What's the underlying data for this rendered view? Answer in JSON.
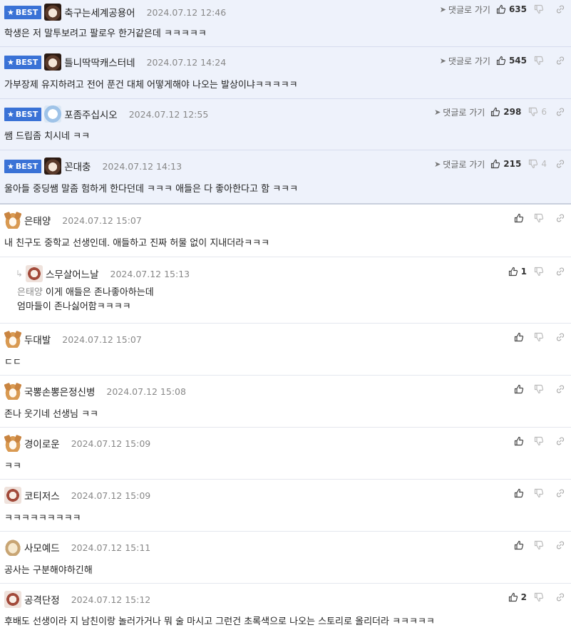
{
  "ui": {
    "reply_link_label": "댓글로 가기",
    "best_label": "BEST"
  },
  "comments": [
    {
      "nick": "축구는세계공용어",
      "date": "2024.07.12 12:46",
      "text": "학생은 저 말투보려고 팔로우 한거같은데 ㅋㅋㅋㅋㅋ",
      "up": "635",
      "down": "",
      "best": true
    },
    {
      "nick": "틀니딱딱캐스터네",
      "date": "2024.07.12 14:24",
      "text": "가부장제 유지하려고 전어 푼건 대체 어떻게해야 나오는 발상이냐ㅋㅋㅋㅋㅋ",
      "up": "545",
      "down": "",
      "best": true
    },
    {
      "nick": "포좀주십시오",
      "date": "2024.07.12 12:55",
      "text": "쌤 드립좀 치시네 ㅋㅋ",
      "up": "298",
      "down": "6",
      "best": true
    },
    {
      "nick": "꼰대충",
      "date": "2024.07.12 14:13",
      "text": "울아들 중딩쌤 말좀 험하게 한다던데 ㅋㅋㅋ 애들은 다 좋아한다고 함 ㅋㅋㅋ",
      "up": "215",
      "down": "4",
      "best": true
    },
    {
      "nick": "은태양",
      "date": "2024.07.12 15:07",
      "text": "내 친구도 중학교 선생인데. 애들하고 진짜 허물 없이 지내더라ㅋㅋㅋ",
      "up": "",
      "down": ""
    },
    {
      "nick": "스무살어느날",
      "date": "2024.07.12 15:13",
      "mention": "은태양",
      "text": "이게 애들은 존나좋아하는데",
      "text2": "엄마들이 존나싫어함ㅋㅋㅋㅋ",
      "up": "1",
      "down": "",
      "reply": true
    },
    {
      "nick": "두대발",
      "date": "2024.07.12 15:07",
      "text": "ㄷㄷ",
      "up": "",
      "down": ""
    },
    {
      "nick": "국뽕손뽕은정신병",
      "date": "2024.07.12 15:08",
      "text": "존나 웃기네 선생님 ㅋㅋ",
      "up": "",
      "down": ""
    },
    {
      "nick": "경이로운",
      "date": "2024.07.12 15:09",
      "text": "ㅋㅋ",
      "up": "",
      "down": ""
    },
    {
      "nick": "코티저스",
      "date": "2024.07.12 15:09",
      "text": "ㅋㅋㅋㅋㅋㅋㅋㅋㅋ",
      "up": "",
      "down": ""
    },
    {
      "nick": "사모예드",
      "date": "2024.07.12 15:11",
      "text": "공사는 구분해야하긴해",
      "up": "",
      "down": ""
    },
    {
      "nick": "공격단정",
      "date": "2024.07.12 15:12",
      "text": "후배도 선생이라 지 남친이랑 놀러가거나 뭐 술 마시고 그런건 초록색으로 나오는 스토리로 올리더라 ㅋㅋㅋㅋㅋ",
      "up": "2",
      "down": ""
    }
  ]
}
